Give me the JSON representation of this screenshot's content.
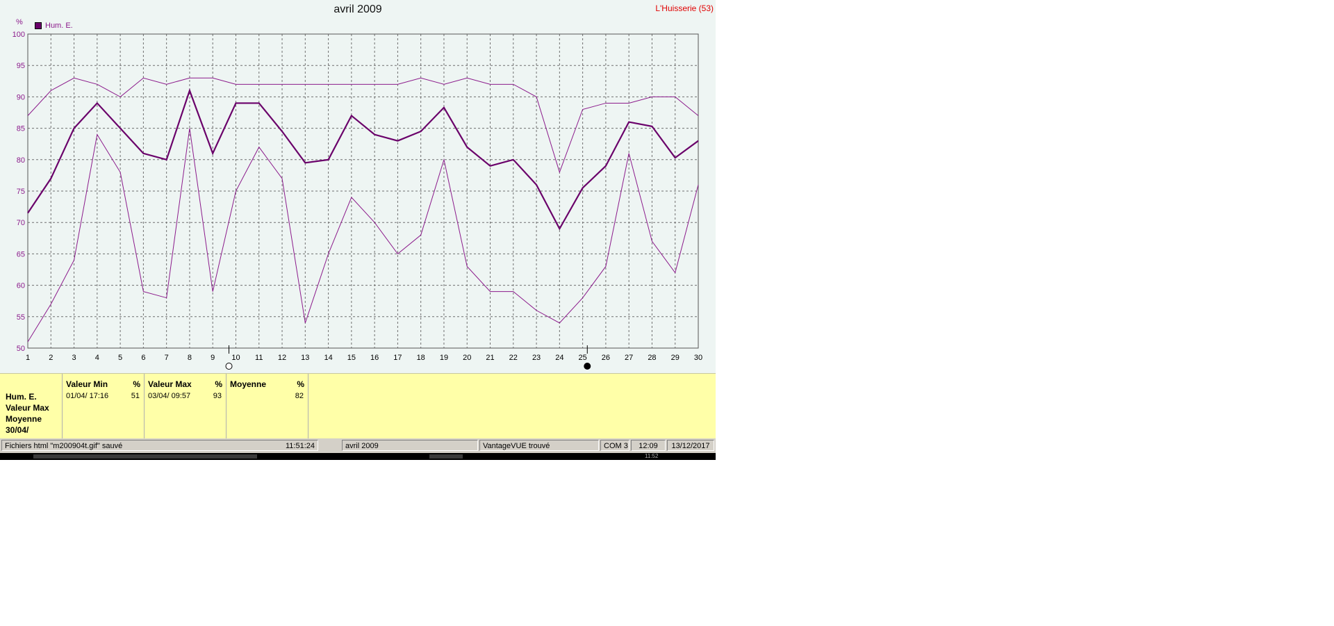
{
  "chart_data": {
    "type": "line",
    "title": "avril 2009",
    "station": "L'Huisserie (53)",
    "ylabel": "%",
    "ylim": [
      50,
      100
    ],
    "yticks": [
      "50",
      "55",
      "60",
      "65",
      "70",
      "75",
      "80",
      "85",
      "90",
      "95",
      "100"
    ],
    "x": [
      1,
      2,
      3,
      4,
      5,
      6,
      7,
      8,
      9,
      10,
      11,
      12,
      13,
      14,
      15,
      16,
      17,
      18,
      19,
      20,
      21,
      22,
      23,
      24,
      25,
      26,
      27,
      28,
      29,
      30
    ],
    "xticks": [
      "1",
      "2",
      "3",
      "4",
      "5",
      "6",
      "7",
      "8",
      "9",
      "10",
      "11",
      "12",
      "13",
      "14",
      "15",
      "16",
      "17",
      "18",
      "19",
      "20",
      "21",
      "22",
      "23",
      "24",
      "25",
      "26",
      "27",
      "28",
      "29",
      "30"
    ],
    "legend": [
      "Hum. E."
    ],
    "series": [
      {
        "name": "Hum. E.",
        "values": [
          71.5,
          77,
          85,
          89,
          85,
          81,
          80,
          91,
          81,
          89,
          89,
          84.5,
          79.5,
          80,
          87,
          84,
          83,
          84.5,
          88.3,
          82,
          79,
          80,
          76,
          69,
          75.5,
          79,
          86,
          85.3,
          80.3,
          83
        ]
      },
      {
        "values": [
          87,
          91,
          93,
          92,
          90,
          93,
          92,
          93,
          93,
          92,
          92,
          92,
          92,
          92,
          92,
          92,
          92,
          93,
          92,
          93,
          92,
          92,
          90,
          78,
          88,
          89,
          89,
          90,
          90,
          87
        ]
      },
      {
        "values": [
          51,
          57,
          64,
          84,
          78,
          59,
          58,
          85,
          59,
          75,
          82,
          77,
          54,
          65,
          74,
          70,
          65,
          68,
          80,
          63,
          59,
          59,
          56,
          54,
          58,
          63,
          81,
          67,
          62,
          76
        ]
      }
    ],
    "grid": true,
    "moon_markers": [
      {
        "day": 9.7,
        "phase": "full"
      },
      {
        "day": 25.2,
        "phase": "new"
      }
    ],
    "colors": {
      "mean": "#6a006a",
      "minmax": "#8b1a8b",
      "background": "#eef5f3"
    }
  },
  "summary": {
    "row_labels": [
      "Hum. E.",
      "Valeur Max",
      "Moyenne",
      "30/04/"
    ],
    "columns": [
      {
        "header": "Valeur Min",
        "unit": "%",
        "time": "01/04/  17:16",
        "value": "51"
      },
      {
        "header": "Valeur Max",
        "unit": "%",
        "time": "03/04/  09:57",
        "value": "93"
      },
      {
        "header": "Moyenne",
        "unit": "%",
        "time": "",
        "value": "82"
      }
    ]
  },
  "status": {
    "message": "Fichiers html  \"m200904t.gif\"  sauvé",
    "time": "11:51:24",
    "month": "avril 2009",
    "device": "VantageVUE trouvé",
    "port": "COM 3",
    "clock": "12:09",
    "date": "13/12/2017"
  },
  "taskbar": {
    "clock": "11:52"
  }
}
